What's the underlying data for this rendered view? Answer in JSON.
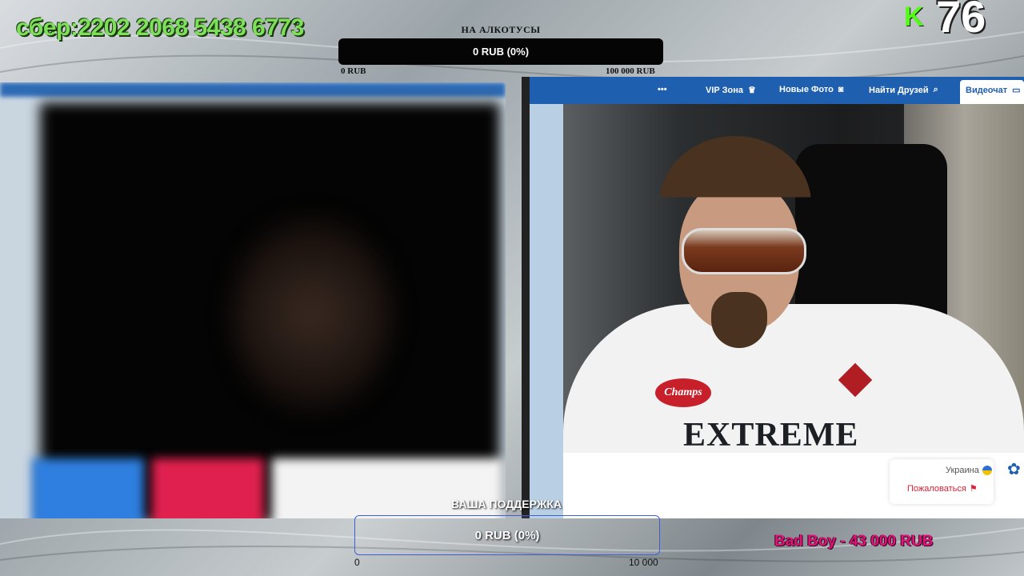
{
  "overlay": {
    "card_number": "сбер:2202 2068 5438 6773",
    "kick_letter": "K",
    "viewer_count": "76"
  },
  "goal_top": {
    "title": "НА АЛКОТУСЫ",
    "progress_text": "0 RUB (0%)",
    "progress": 0,
    "min_label": "0 RUB",
    "max_label": "100 000 RUB"
  },
  "site": {
    "nav": {
      "videochat": "Видеочат",
      "find_friends": "Найти Друзей",
      "new_photos": "Новые Фото",
      "vip_zone": "VIP Зона",
      "more": "•••"
    },
    "country": "Украина",
    "report": "Пожаловаться",
    "shirt_brand": "EXTREME",
    "patch_text": "Champs",
    "accent_color": "#1f5fb0"
  },
  "goal_bottom": {
    "title": "ВАША ПОДДЕРЖКА",
    "progress_text": "0 RUB (0%)",
    "progress": 0,
    "min_label": "0",
    "max_label": "10 000"
  },
  "top_donor": "Bad Boy - 43 000 RUB"
}
